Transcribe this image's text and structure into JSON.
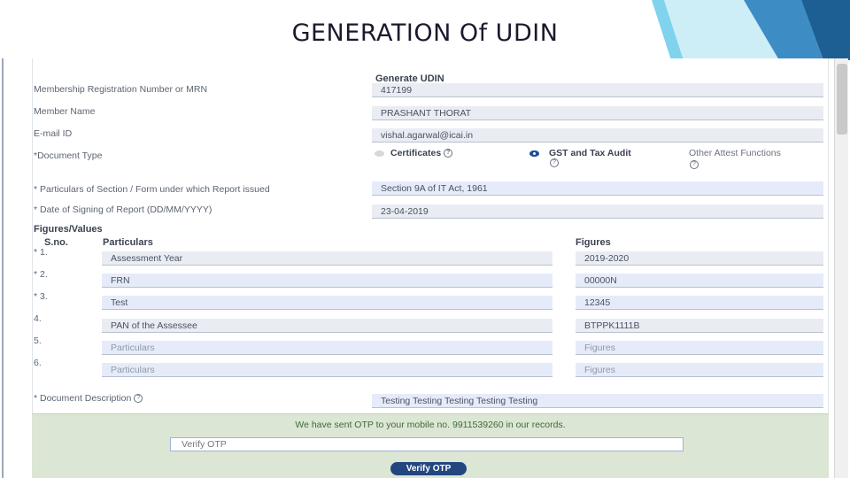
{
  "slide": {
    "title": "GENERATION Of UDIN"
  },
  "form": {
    "section_title": "Generate UDIN",
    "rows": [
      {
        "label": "Membership Registration Number or MRN",
        "value": "417199"
      },
      {
        "label": "Member Name",
        "value": "PRASHANT  THORAT"
      },
      {
        "label": "E-mail ID",
        "value": "vishal.agarwal@icai.in"
      }
    ],
    "document_type": {
      "label": "*Document Type",
      "options": [
        {
          "label": "Certificates",
          "selected": false
        },
        {
          "label": "GST and Tax Audit",
          "selected": true
        },
        {
          "label": "Other Attest Functions",
          "selected": false
        }
      ]
    },
    "particulars_section": {
      "label": "* Particulars of Section / Form under which Report issued",
      "value": "Section 9A of IT Act, 1961"
    },
    "date_signing": {
      "label": "* Date of Signing of Report (DD/MM/YYYY)",
      "value": "23-04-2019"
    },
    "figures": {
      "title": "Figures/Values",
      "col_sno": "S.no.",
      "col_particulars": "Particulars",
      "col_figures": "Figures",
      "rows": [
        {
          "sno": "* 1.",
          "particular": "Assessment Year",
          "figure": "2019-2020",
          "placeholder": false
        },
        {
          "sno": "* 2.",
          "particular": "FRN",
          "figure": "00000N",
          "placeholder": false
        },
        {
          "sno": "* 3.",
          "particular": "Test",
          "figure": "12345",
          "placeholder": false
        },
        {
          "sno": "4.",
          "particular": "PAN of the Assessee",
          "figure": "BTPPK1111B",
          "placeholder": false
        },
        {
          "sno": "5.",
          "particular": "Particulars",
          "figure": "Figures",
          "placeholder": true
        },
        {
          "sno": "6.",
          "particular": "Particulars",
          "figure": "Figures",
          "placeholder": true
        }
      ]
    },
    "document_description": {
      "label": "* Document Description",
      "value": "Testing Testing Testing Testing Testing"
    },
    "otp": {
      "message": "We have sent OTP to your mobile no. 9911539260 in our records.",
      "placeholder": "Verify OTP",
      "button": "Verify OTP"
    }
  },
  "icons": {
    "help": "question-circle-icon",
    "radio": "radio-button-icon"
  },
  "colors": {
    "accent": "#23467f",
    "otp_bg": "#dce6d4",
    "corner_blue": "#1f6fa8"
  }
}
